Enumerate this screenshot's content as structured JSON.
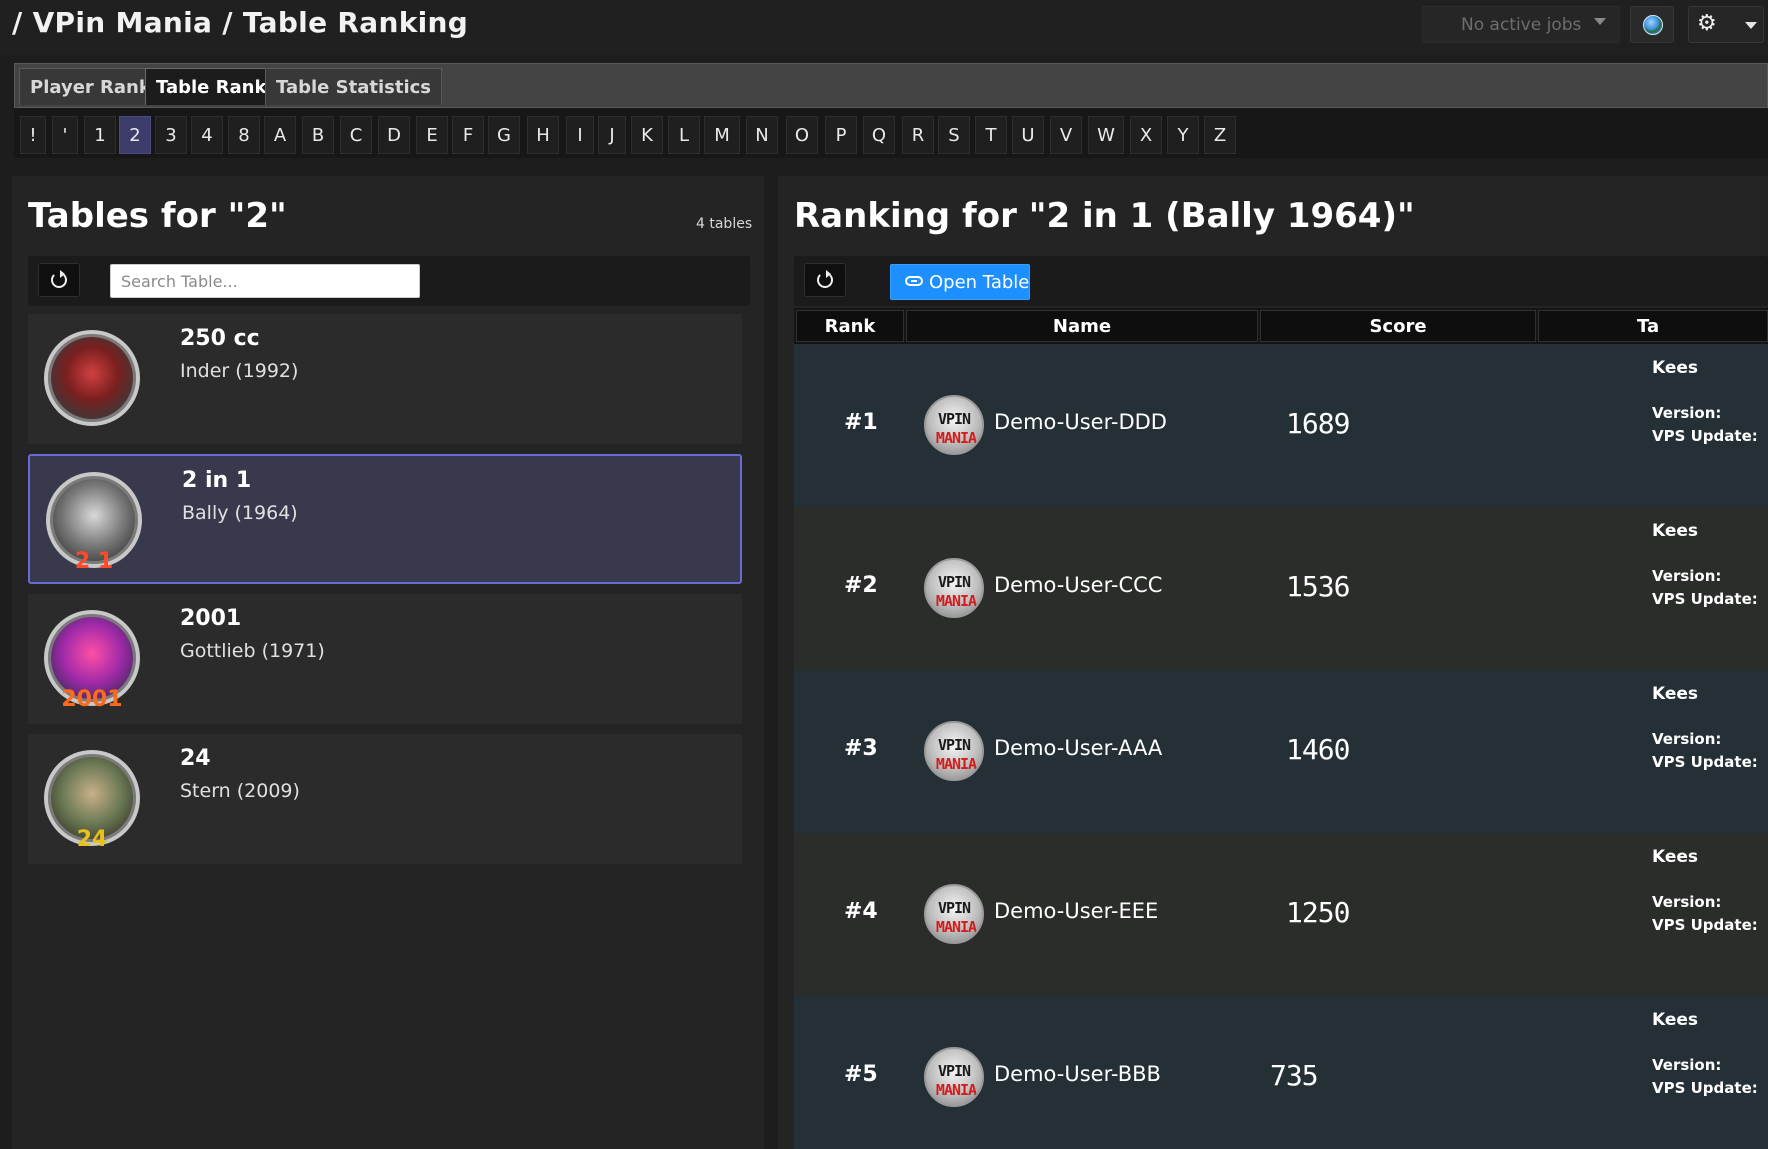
{
  "header": {
    "title": "/ VPin Mania / Table Ranking",
    "jobs_placeholder": "No active jobs"
  },
  "tabs": [
    {
      "label": "Player Ranking",
      "active": false
    },
    {
      "label": "Table Ranking",
      "active": true
    },
    {
      "label": "Table Statistics",
      "active": false
    }
  ],
  "letters": [
    "!",
    "'",
    "1",
    "2",
    "3",
    "4",
    "8",
    "A",
    "B",
    "C",
    "D",
    "E",
    "F",
    "G",
    "H",
    "I",
    "J",
    "K",
    "L",
    "M",
    "N",
    "O",
    "P",
    "Q",
    "R",
    "S",
    "T",
    "U",
    "V",
    "W",
    "X",
    "Y",
    "Z"
  ],
  "active_letter": "2",
  "left": {
    "title": "Tables for \"2\"",
    "count": "4 tables",
    "search_placeholder": "Search Table...",
    "tables": [
      {
        "name": "250 cc",
        "maker": "Inder (1992)",
        "selected": false,
        "wheel_text": ""
      },
      {
        "name": "2 in 1",
        "maker": "Bally (1964)",
        "selected": true,
        "wheel_text": "2 1"
      },
      {
        "name": "2001",
        "maker": "Gottlieb (1971)",
        "selected": false,
        "wheel_text": "2001"
      },
      {
        "name": "24",
        "maker": "Stern (2009)",
        "selected": false,
        "wheel_text": "24"
      }
    ]
  },
  "right": {
    "title": "Ranking for \"2 in 1 (Bally 1964)\"",
    "open_button": "Open Table",
    "columns": [
      "Rank",
      "Name",
      "Score",
      "Ta"
    ],
    "avatar_text_top": "VPIN",
    "avatar_text_bottom": "MANIA",
    "rows": [
      {
        "rank": "#1",
        "name": "Demo-User-DDD",
        "score": "1689",
        "submitter": "Kees",
        "version_label": "Version:",
        "vps_label": "VPS Update:"
      },
      {
        "rank": "#2",
        "name": "Demo-User-CCC",
        "score": "1536",
        "submitter": "Kees",
        "version_label": "Version:",
        "vps_label": "VPS Update:"
      },
      {
        "rank": "#3",
        "name": "Demo-User-AAA",
        "score": "1460",
        "submitter": "Kees",
        "version_label": "Version:",
        "vps_label": "VPS Update:"
      },
      {
        "rank": "#4",
        "name": "Demo-User-EEE",
        "score": "1250",
        "submitter": "Kees",
        "version_label": "Version:",
        "vps_label": "VPS Update:"
      },
      {
        "rank": "#5",
        "name": "Demo-User-BBB",
        "score": "735",
        "submitter": "Kees",
        "version_label": "Version:",
        "vps_label": "VPS Update:"
      }
    ]
  },
  "colors": {
    "accent": "#1e8fff",
    "selected_letter": "#3c3c6b",
    "selected_item_border": "#6a6ad6",
    "row_a": "#243036",
    "row_b": "#2a2d2a"
  },
  "icons": {
    "refresh": "refresh-icon",
    "link": "link-icon",
    "globe": "globe-icon",
    "settings": "gear-icon",
    "dropdown": "chevron-down-icon"
  }
}
